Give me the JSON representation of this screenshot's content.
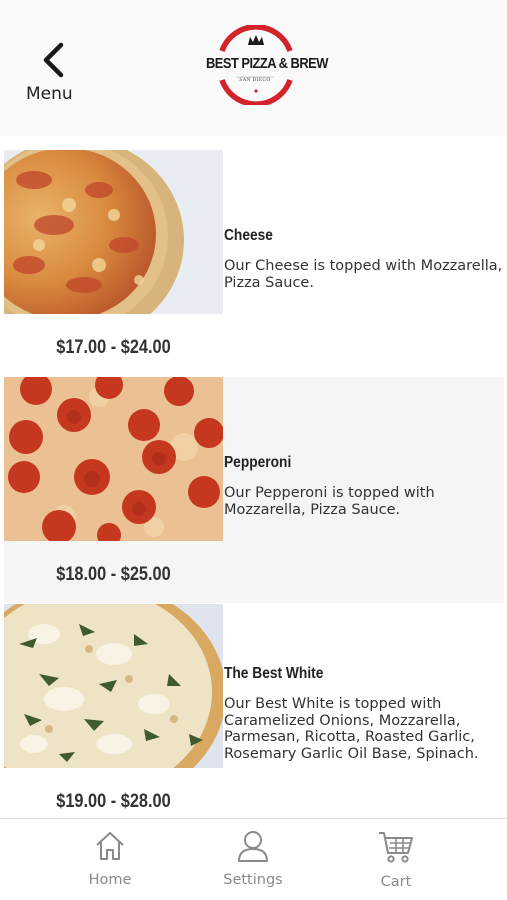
{
  "header": {
    "back_label": "Menu",
    "logo_text": "BEST PIZZA & BREW",
    "logo_subtext": "SAN DIEGO"
  },
  "menu_items": [
    {
      "name": "Cheese",
      "description": "Our Cheese is topped with Mozzarella, Pizza Sauce.",
      "price": "$17.00 - $24.00",
      "image": "cheese-pizza-photo"
    },
    {
      "name": "Pepperoni",
      "description": "Our Pepperoni is topped with Mozzarella, Pizza Sauce.",
      "price": "$18.00 - $25.00",
      "image": "pepperoni-pizza-photo"
    },
    {
      "name": "The Best White",
      "description": "Our  Best White is topped with Caramelized Onions, Mozzarella, Parmesan, Ricotta, Roasted Garlic, Rosemary Garlic Oil Base, Spinach.",
      "price": "$19.00 - $28.00",
      "image": "white-pizza-photo"
    }
  ],
  "tabbar": {
    "items": [
      {
        "label": "Home",
        "icon": "home-icon"
      },
      {
        "label": "Settings",
        "icon": "user-icon"
      },
      {
        "label": "Cart",
        "icon": "cart-icon"
      }
    ]
  },
  "colors": {
    "logo_red": "#d2232a",
    "tab_gray": "#8a8a8a",
    "row_shade": "#f5f5f5"
  }
}
